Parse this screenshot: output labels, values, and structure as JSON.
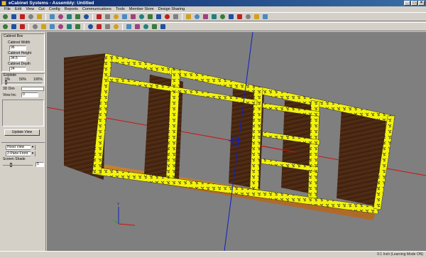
{
  "window": {
    "title": "eCabinet Systems - Assembly: Untitled"
  },
  "menu": [
    "File",
    "Edit",
    "View",
    "Cut",
    "Config",
    "Reports",
    "Communications",
    "Tools",
    "Member Store",
    "Design Sharing"
  ],
  "left_panel": {
    "cabinet_box_title": "Cabinet Box",
    "width_label": "Cabinet Width",
    "width_value": "96",
    "height_label": "Cabinet Height",
    "height_value": "34.5",
    "depth_label": "Cabinet Depth",
    "depth_value": "24",
    "explode_title": "Explode",
    "explode_ticks": [
      "0%",
      "50%",
      "100%"
    ],
    "dim_label": "3D Dim",
    "view_inc_label": "View Inc",
    "view_inc_value": "0",
    "update_button": "Update View",
    "view_select": "Hood View",
    "render_select": "2-Pane Front",
    "screen_shade_label": "Screen Shade",
    "shade_value": "5"
  },
  "status": {
    "message": "0:1 Inch (Learning Mode ON)"
  },
  "colors": {
    "title_bar": "#0a246a",
    "viewport_bg": "#7f7f7f",
    "panel_edge": "#f2f20c",
    "wood": "#4a2812",
    "toe_kick": "#b06a28",
    "axis_x": "#d01010",
    "axis_y": "#1020c0"
  },
  "toolbar1_icons": [
    "back-icon",
    "forward-icon",
    "stop-icon",
    "home-icon",
    "refresh-icon",
    "new-icon",
    "open-icon",
    "save-icon",
    "undo-icon",
    "zoom-icon",
    "tool1-icon",
    "tool2-icon",
    "tool3-icon",
    "tool4-icon",
    "tool5-icon",
    "tool6-icon",
    "tool7-icon",
    "tool8-icon",
    "tool9-icon",
    "tool10-icon",
    "tool11-icon",
    "tool12-icon",
    "tool13-icon",
    "tool14-icon",
    "tool15-icon",
    "tool16-icon",
    "tool17-icon",
    "tool18-icon",
    "tool19-icon",
    "tool20-icon"
  ],
  "toolbar2_icons": [
    "select-icon",
    "camera-icon",
    "print-icon",
    "grid-icon",
    "part-icon",
    "door-icon",
    "drawer-icon",
    "face-icon",
    "box-icon",
    "paint-icon",
    "rotate-icon",
    "pencil-icon",
    "measure-icon",
    "dim-icon",
    "flip-icon",
    "delete-icon",
    "lock-icon",
    "layer-icon"
  ]
}
